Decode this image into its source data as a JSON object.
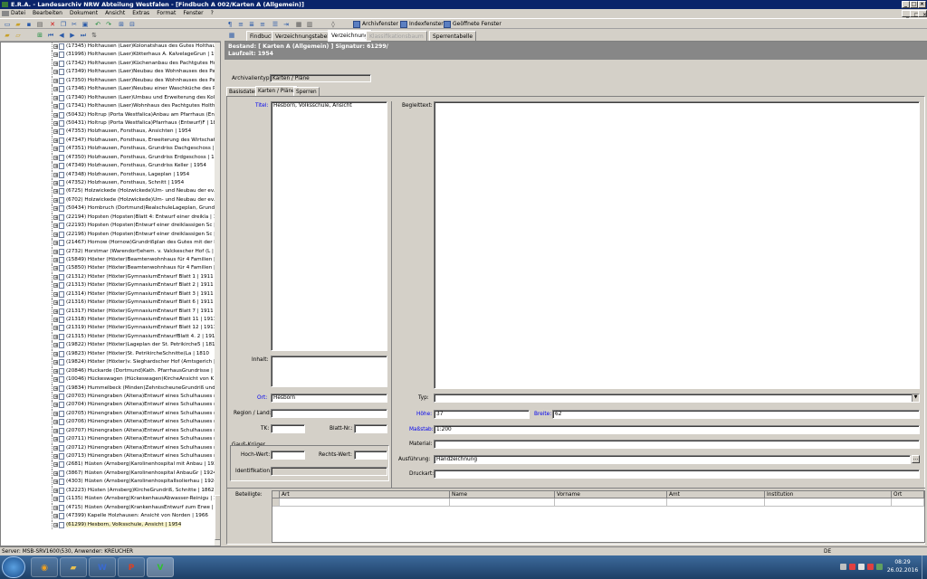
{
  "window": {
    "title": "E.R.A. - Landesarchiv NRW Abteilung Westfalen - [Findbuch A 002/Karten A (Allgemein)]"
  },
  "menu": [
    "Datei",
    "Bearbeiten",
    "Dokument",
    "Ansicht",
    "Extras",
    "Format",
    "Fenster",
    "?"
  ],
  "toolbar": {
    "archivfenster": "Archivfenster",
    "indexfenster": "Indexfenster",
    "geoeffnete": "Geöffnete Fenster"
  },
  "tree": {
    "items": [
      "(17345) Holthausen (Laer)Kolonatshaus des Gutes Holthau | 18",
      "(31996) Holthausen (Laer)Kötterhaus A. KalvelageGrun | 1911",
      "(17342) Holthausen (Laer)Küchenanbau des Pachtgutes Hol | 18",
      "(17349) Holthausen (Laer)Neubau des Wohnhauses des Pach | 1",
      "(17350) Holthausen (Laer)Neubau des Wohnhauses des Pach | 1",
      "(17346) Holthausen (Laer)Neubau einer Waschküche des Pa | 18",
      "(17340) Holthausen (Laer)Umbau und Erweiterung des Kolo | 18",
      "(17341) Holthausen (Laer)Wohnhaus des Pachtgutes Holtha | 18",
      "(50432) Holtrup (Porta Westfalica)Anbau am Pfarrhaus (En | 18",
      "(50431) Holtrup (Porta Westfalica)Pfarrhaus (Entwurf)F | 1801",
      "(47353) Holzhausen, Forsthaus, Ansichten | 1954",
      "(47347) Holzhausen, Forsthaus, Erweiterung des Wirtschafts | 1",
      "(47351) Holzhausen, Forsthaus, Grundriss Dachgeschoss | 1954",
      "(47350) Holzhausen, Forsthaus, Grundriss Erdgeschoss | 1954",
      "(47349) Holzhausen, Forsthaus, Grundriss Keller | 1954",
      "(47348) Holzhausen, Forsthaus, Lageplan | 1954",
      "(47352) Holzhausen, Forsthaus, Schnitt | 1954",
      "(6725) Holzwickede (Holzwickede)Um- und Neubau der ev. | 192",
      "(6702) Holzwickede (Holzwickede)Um- und Neubau der ev. | 192",
      "(50434) Hombruch (Dortmund)RealschuleLageplan, Grundri | 19",
      "(22194) Hopsten (Hopsten)Blatt 4: Entwurf einer dreikla | 1909",
      "(22193) Hopsten (Hopsten)Entwurf einer dreiklassigen Sc | 1909",
      "(22196) Hopsten (Hopsten)Entwurf einer dreiklassigen Sc | 1909",
      "(21467) Hornow (Hornow)Grundrißplan des Gutes mit der P | 178",
      "(2732) Horstmar (Warendorf)ehem. v. Valckescher Hof (L | 175",
      "(15849) Höxter (Höxter)Beamtenwohnhaus für 4 Familien | 192",
      "(15850) Höxter (Höxter)Beamtenwohnhaus für 4 Familien | 192",
      "(21312) Höxter (Höxter)GymnasiumEntwurf  Blatt 1 | 1911",
      "(21313) Höxter (Höxter)GymnasiumEntwurf  Blatt 2 | 1911",
      "(21314) Höxter (Höxter)GymnasiumEntwurf  Blatt 3 | 1911",
      "(21316) Höxter (Höxter)GymnasiumEntwurf  Blatt 6 | 1911",
      "(21317) Höxter (Höxter)GymnasiumEntwurf  Blatt 7 | 1911",
      "(21318) Höxter (Höxter)GymnasiumEntwurf  Blatt 11 | 1911",
      "(21319) Höxter (Höxter)GymnasiumEntwurf  Blatt 12 | 1911",
      "(21315) Höxter (Höxter)GymnasiumEntwurfBlatt 4. 2 | 1911",
      "(19822) Höxter (Höxter)Lageplan der St. Petrikirche5 | 1810",
      "(19823) Höxter (Höxter)St. PetrikircheSchnitte(La | 1810",
      "(19824) Höxter (Höxter)v. Sieghardscher Hof (Amtsgerich | 181",
      "(20846) Huckarde (Dortmund)Kath. PfarrhausGrundrisse | 1840",
      "(10046) Hückeswagen (Hückeswagen)KircheAnsicht von K | 183",
      "(19834) Hummelbeck (Minden)ZehntscheuneGrundriß und | 180",
      "(20703) Hünengraben (Altena)Entwurf eines Schulhauses m | 18",
      "(20704) Hünengraben (Altena)Entwurf eines Schulhauses m | 18",
      "(20705) Hünengraben (Altena)Entwurf eines Schulhauses m | 18",
      "(20706) Hünengraben (Altena)Entwurf eines Schulhauses m | 18",
      "(20707) Hünengraben (Altena)Entwurf eines Schulhauses m | 18",
      "(20711) Hünengraben (Altena)Entwurf eines Schulhauses m | 18",
      "(20712) Hünengraben (Altena)Entwurf eines Schulhauses m | 18",
      "(20713) Hünengraben (Altena)Entwurf eines Schulhauses m | 18",
      "(2681) Hüsten (Arnsberg)Karolinenhospital mit Anbau | 1924",
      "(3867) Hüsten (Arnsberg)Karolinenhospital AnbauGr | 1924",
      "(4303) Hüsten (Arnsberg)KarolinenhospitalIsolierhau | 1924",
      "(32223) Hüsten (Arnsberg)KircheGrundriß, Schnitte | 1862",
      "(1135) Hüsten (Arnsberg)KrankenhausAbwasser-Reinigu | 1912",
      "(4715) Hüsten (Arnsberg)KrankenhausEntwurf zum Erwe | 1895",
      "(47399) Kapelle Holzhausen: Ansicht von Norden | 1966",
      "(61299) Hesborn, Volksschule, Ansicht | 1954"
    ]
  },
  "tabs": [
    {
      "label": "Findbuch"
    },
    {
      "label": "Verzeichnungstabelle"
    },
    {
      "label": "Verzeichnung"
    },
    {
      "label": "Klassifikationsbaum"
    },
    {
      "label": "Sperrentabelle"
    }
  ],
  "header": {
    "line1": "Bestand: [ Karten A (Allgemein) ]  Signatur: 61299/",
    "line2": "Laufzeit: 1954"
  },
  "form": {
    "archivalientyp_label": "Archivalientyp:",
    "archivalientyp_value": "Karten / Pläne",
    "inner_tabs": [
      "Basisdaten",
      "Karten / Pläne",
      "Sperren"
    ],
    "titel_label": "Titel:",
    "titel_value": "Hesborn, Volksschule, Ansicht",
    "begleittext_label": "Begleittext:",
    "inhalt_label": "Inhalt:",
    "ort_label": "Ort:",
    "ort_value": "Hesborn",
    "region_label": "Region / Land:",
    "tk_label": "TK:",
    "blatt_label": "Blatt-Nr.:",
    "gauss_label": "Gauß-Krüger",
    "hochwert_label": "Hoch-Wert:",
    "rechtswert_label": "Rechts-Wert:",
    "identifikation_label": "Identifikation:",
    "typ_label": "Typ:",
    "hoehe_label": "Höhe:",
    "hoehe_value": "37",
    "breite_label": "Breite:",
    "breite_value": "62",
    "massstab_label": "Maßstab:",
    "massstab_value": "1:200",
    "material_label": "Material:",
    "ausfuehrung_label": "Ausführung:",
    "ausfuehrung_value": "Handzeichnung",
    "druckart_label": "Druckart:",
    "beteiligte_label": "Beteiligte:",
    "grid_columns": [
      "Art",
      "Name",
      "Vorname",
      "Amt",
      "Institution",
      "Ort"
    ]
  },
  "status": {
    "server": "Server: MSB-SRV1600\\530, Anwender: KREUCHER",
    "lang": "DE"
  },
  "taskbar": {
    "time": "08:29",
    "date": "26.02.2016"
  },
  "colors": {
    "titlebar": "#0a246a",
    "header": "#878787",
    "blue_label": "#0000ee",
    "selected_row": "#f7f3c9"
  }
}
